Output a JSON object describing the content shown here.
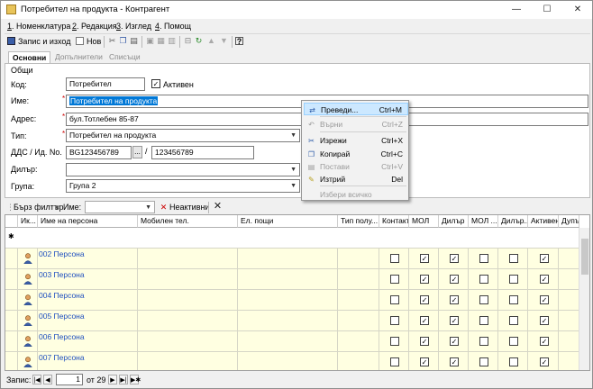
{
  "window": {
    "title": "Потребител на продукта - Контрагент",
    "minimize": "—",
    "maximize": "☐",
    "close": "✕"
  },
  "menu": [
    {
      "num": "1",
      "label": ". Номенклатура"
    },
    {
      "num": "2",
      "label": ". Редакция"
    },
    {
      "num": "3",
      "label": ". Изглед"
    },
    {
      "num": "4",
      "label": ". Помощ"
    }
  ],
  "toolbar": {
    "save_exit": "Запис и изход",
    "new": "Нов"
  },
  "tabs": [
    "Основни",
    "Допълнители",
    "Списъци"
  ],
  "general": {
    "section": "Общи",
    "code_label": "Код:",
    "code_value": "Потребител",
    "active_label": "Активен",
    "active_checked": true,
    "name_label": "Име:",
    "name_value": "Потребител на продукта",
    "address_label": "Адрес:",
    "address_value": "бул.Тотлебен 85-87",
    "type_label": "Тип:",
    "type_value": "Потребител на продукта",
    "vat_label": "ДДС / Ид. No.",
    "vat_value": "BG123456789",
    "vat_dots": "...",
    "vat_slash": "/",
    "id_value": "123456789",
    "dealer_label": "Дилър:",
    "dealer_value": "",
    "group_label": "Група:",
    "group_value": "Група 2"
  },
  "filter": {
    "quick_filter": "Бърз филтър",
    "field": "Име:",
    "inactive": "Неактивни"
  },
  "grid": {
    "columns": [
      "Ик...",
      "Име на персона",
      "Мобилен тел.",
      "Ел. пощи",
      "Тип полу...",
      "Контакт",
      "МОЛ",
      "Дилър",
      "МОЛ ...",
      "Дилър...",
      "Активен",
      "Дупъ"
    ],
    "new_row_marker": "✱",
    "rows": [
      {
        "name": "002 Персона",
        "contact": false,
        "mol": true,
        "dealer": true,
        "mol2": false,
        "dealer2": false,
        "active": true
      },
      {
        "name": "003 Персона",
        "contact": false,
        "mol": true,
        "dealer": true,
        "mol2": false,
        "dealer2": false,
        "active": true
      },
      {
        "name": "004 Персона",
        "contact": false,
        "mol": true,
        "dealer": true,
        "mol2": false,
        "dealer2": false,
        "active": true
      },
      {
        "name": "005 Персона",
        "contact": false,
        "mol": true,
        "dealer": true,
        "mol2": false,
        "dealer2": false,
        "active": true
      },
      {
        "name": "006 Персона",
        "contact": false,
        "mol": true,
        "dealer": true,
        "mol2": false,
        "dealer2": false,
        "active": true
      },
      {
        "name": "007 Персона",
        "contact": false,
        "mol": true,
        "dealer": true,
        "mol2": false,
        "dealer2": false,
        "active": true
      }
    ]
  },
  "status": {
    "record_label": "Запис:",
    "current": "1",
    "of_total": "от 29"
  },
  "context_menu": {
    "items": [
      {
        "label": "Преведи...",
        "key": "Ctrl+M",
        "disabled": false,
        "highlight": true,
        "icon": "translate-icon"
      },
      {
        "label": "Върни",
        "key": "Ctrl+Z",
        "disabled": true,
        "icon": "undo-icon"
      },
      {
        "label": "Изрежи",
        "key": "Ctrl+X",
        "disabled": false,
        "icon": "cut-icon"
      },
      {
        "label": "Копирай",
        "key": "Ctrl+C",
        "disabled": false,
        "icon": "copy-icon"
      },
      {
        "label": "Постави",
        "key": "Ctrl+V",
        "disabled": true,
        "icon": "paste-icon"
      },
      {
        "label": "Изтрий",
        "key": "Del",
        "disabled": false,
        "icon": "eraser-icon"
      },
      {
        "label": "Избери всичко",
        "key": "",
        "disabled": true,
        "icon": ""
      }
    ]
  }
}
